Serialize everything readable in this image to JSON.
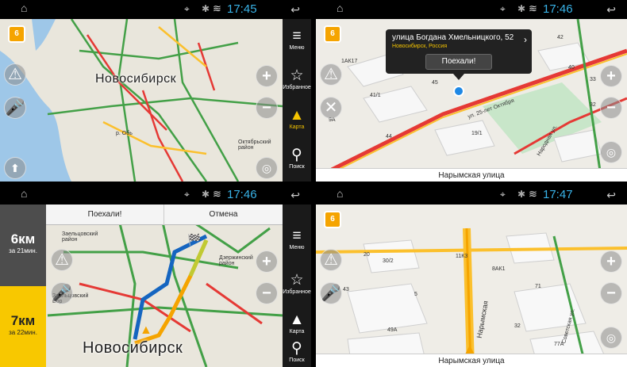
{
  "screens": [
    {
      "status": {
        "time": "17:45"
      },
      "city_label": "Новосибирск",
      "sidebar": [
        {
          "label": "Меню",
          "icon": "menu-icon"
        },
        {
          "label": "Избранное",
          "icon": "star-icon"
        },
        {
          "label": "Карта",
          "icon": "navigation-arrow-icon"
        },
        {
          "label": "Поиск",
          "icon": "search-icon"
        }
      ],
      "map_labels": {
        "river": "р. Обь",
        "district": "Октябрьский район"
      }
    },
    {
      "status": {
        "time": "17:46"
      },
      "popup": {
        "address": "улица Богдана Хмельницкого, 52",
        "subtitle": "Новосибирск, Россия",
        "go_button": "Поехали!"
      },
      "bottom_street": "Нарымская улица",
      "map_labels": [
        "1АК17",
        "45",
        "41/1",
        "40",
        "33",
        "32",
        "19/1",
        "44",
        "9А",
        "42"
      ],
      "street_labels": [
        "ул. 25-лет Октября",
        "Народная ул."
      ]
    },
    {
      "status": {
        "time": "17:46"
      },
      "top_buttons": {
        "go": "Поехали!",
        "cancel": "Отмена"
      },
      "routes": [
        {
          "distance": "6км",
          "time": "за 21мин."
        },
        {
          "distance": "7км",
          "time": "за 22мин."
        }
      ],
      "city_label": "Новосибирск",
      "map_labels": {
        "zaeltsovsky": "Заельцовский район",
        "dzerzhinsky": "Дзержинский район",
        "bor": "Заельцовский Бор"
      },
      "sidebar": [
        {
          "label": "Меню",
          "icon": "menu-icon"
        },
        {
          "label": "Избранное",
          "icon": "star-icon"
        },
        {
          "label": "Карта",
          "icon": "navigation-arrow-icon"
        },
        {
          "label": "Поиск",
          "icon": "search-icon"
        }
      ]
    },
    {
      "status": {
        "time": "17:47"
      },
      "bottom_street": "Нарымская улица",
      "map_labels": [
        "20",
        "30/2",
        "11К3",
        "8АК1",
        "5",
        "43",
        "49А",
        "77А",
        "71",
        "32"
      ],
      "street_labels": [
        "Нарымская",
        "Советская ул."
      ]
    }
  ]
}
